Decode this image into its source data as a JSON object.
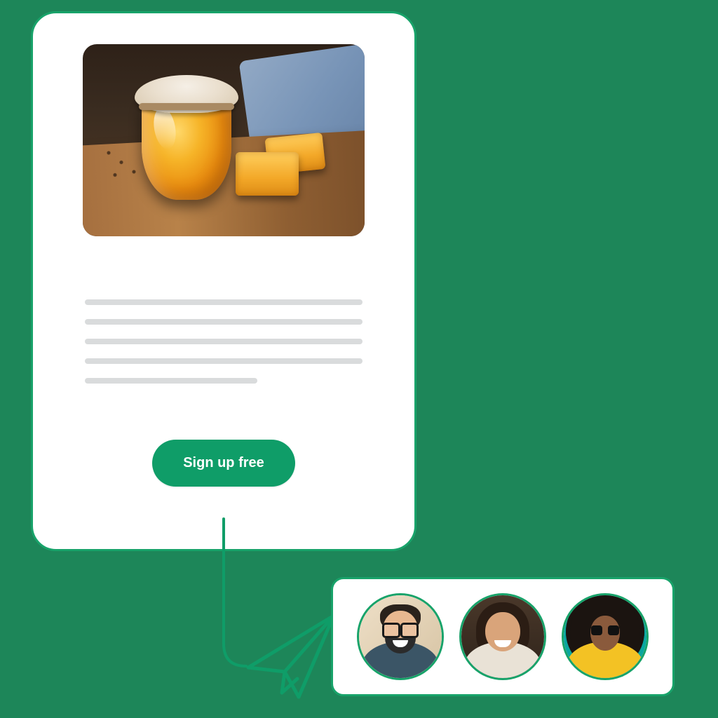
{
  "card": {
    "cta_label": "Sign up free",
    "image_alt": "honey-jar-photo"
  },
  "subscribers": {
    "avatars": [
      {
        "name": "subscriber-avatar-1"
      },
      {
        "name": "subscriber-avatar-2"
      },
      {
        "name": "subscriber-avatar-3"
      }
    ]
  },
  "colors": {
    "accent": "#0f9d68",
    "background": "#1d8659",
    "card_border": "#18a36a"
  }
}
